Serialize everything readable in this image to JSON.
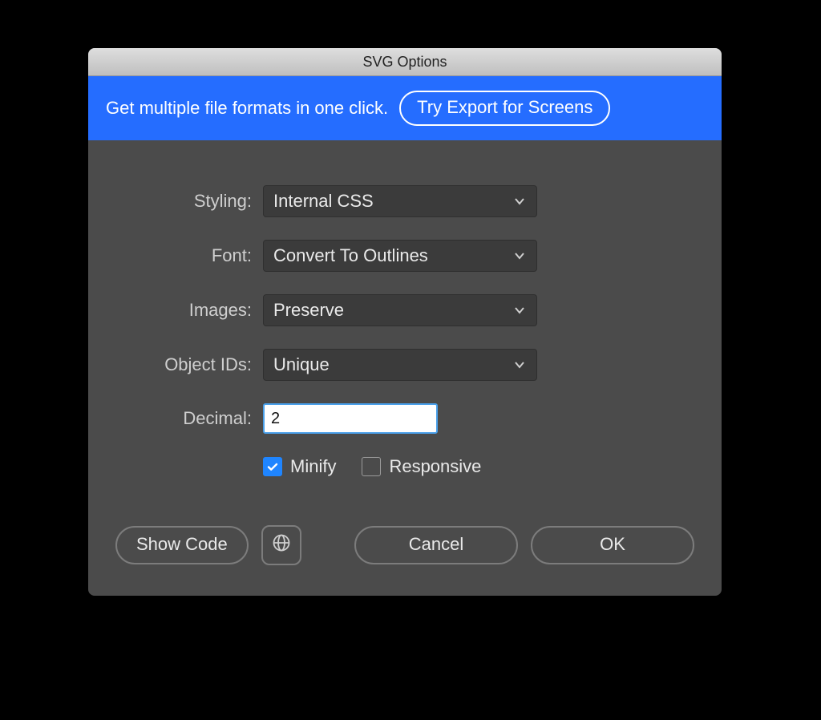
{
  "title": "SVG Options",
  "promo": {
    "text": "Get multiple file formats in one click.",
    "cta": "Try Export for Screens"
  },
  "form": {
    "styling": {
      "label": "Styling:",
      "value": "Internal CSS"
    },
    "font": {
      "label": "Font:",
      "value": "Convert To Outlines"
    },
    "images": {
      "label": "Images:",
      "value": "Preserve"
    },
    "objectIds": {
      "label": "Object IDs:",
      "value": "Unique"
    },
    "decimal": {
      "label": "Decimal:",
      "value": "2"
    },
    "minify": {
      "label": "Minify",
      "checked": true
    },
    "responsive": {
      "label": "Responsive",
      "checked": false
    }
  },
  "footer": {
    "showCode": "Show Code",
    "cancel": "Cancel",
    "ok": "OK"
  }
}
